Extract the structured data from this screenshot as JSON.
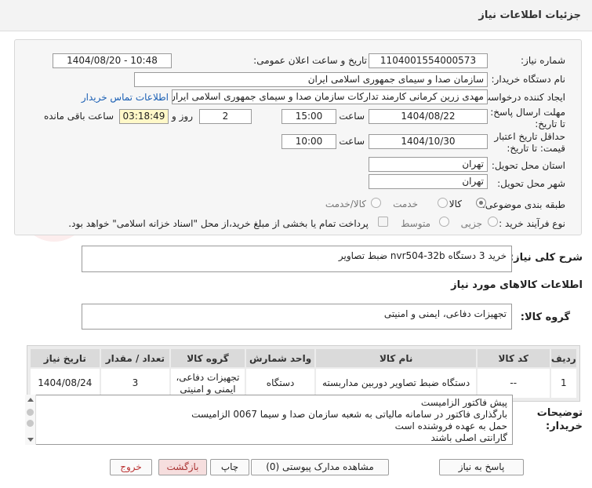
{
  "header": {
    "title": "جزئیات اطلاعات نیاز"
  },
  "form": {
    "need_number_label": "شماره نیاز:",
    "need_number": "1104001554000573",
    "announce_label": "تاریخ و ساعت اعلان عمومی:",
    "announce_value": "1404/08/20 - 10:48",
    "buyer_org_label": "نام دستگاه خریدار:",
    "buyer_org": "سازمان صدا و سیمای جمهوری اسلامی ایران",
    "requester_label": "ایجاد کننده درخواست:",
    "requester": "مهدی زرین کرمانی کارمند تدارکات سازمان صدا و سیمای جمهوری اسلامی ایران",
    "contact_link": "اطلاعات تماس خریدار",
    "deadline_label": "مهلت ارسال پاسخ: تا تاریخ:",
    "deadline_date": "1404/08/22",
    "time_label": "ساعت",
    "deadline_time": "15:00",
    "days_value": "2",
    "days_and": "روز و",
    "remaining_time": "03:18:49",
    "remaining_label": "ساعت باقی مانده",
    "validity_label": "حداقل تاریخ اعتبار قیمت: تا تاریخ:",
    "validity_date": "1404/10/30",
    "validity_time": "10:00",
    "province_label": "استان محل تحویل:",
    "province": "تهران",
    "city_label": "شهر محل تحویل:",
    "city": "تهران",
    "category_label": "طبقه بندی موضوعی:",
    "category_options": [
      "کالا",
      "خدمت",
      "کالا/خدمت"
    ],
    "process_label": "نوع فرآیند خرید :",
    "process_options": [
      "جزیی",
      "متوسط"
    ],
    "payment_note": "پرداخت تمام یا بخشی از مبلغ خرید،از محل \"اسناد خزانه اسلامی\" خواهد بود."
  },
  "description": {
    "label": "شرح کلی نیاز:",
    "text": "خرید 3 دستگاه nvr504-32b ضبط تصاویر"
  },
  "goods": {
    "section_title": "اطلاعات کالاهای مورد نیاز",
    "group_label": "گروه کالا:",
    "group_value": "تجهیزات دفاعی، ایمنی و امنیتی"
  },
  "table": {
    "headers": [
      "ردیف",
      "کد کالا",
      "نام کالا",
      "واحد شمارش",
      "گروه کالا",
      "تعداد / مقدار",
      "تاریخ نیاز"
    ],
    "rows": [
      [
        "1",
        "--",
        "دستگاه ضبط تصاویر دوربین مداربسته",
        "دستگاه",
        "تجهیزات دفاعی، ایمنی و امنیتی",
        "3",
        "1404/08/24"
      ]
    ]
  },
  "notes": {
    "label": "توضیحات خریدار:",
    "lines": [
      "پیش فاکتور الزامیست",
      "بارگذاری فاکتور در سامانه مالیاتی به شعبه سازمان صدا و سیما 0067 الزامیست",
      "حمل به عهده فروشنده است",
      "گارانتی اصلی باشند"
    ]
  },
  "watermark": {
    "text": "AriaTender.neT"
  },
  "buttons": {
    "reply": "پاسخ به نیاز",
    "attachments": "مشاهده مدارک پیوستی (0)",
    "print": "چاپ",
    "back": "بازگشت",
    "exit": "خروج"
  }
}
